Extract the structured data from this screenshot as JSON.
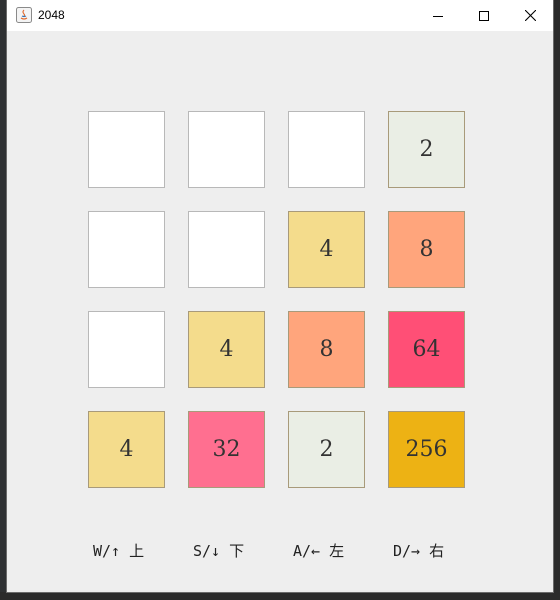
{
  "window": {
    "title": "2048"
  },
  "board": {
    "rows": [
      [
        {
          "value": ""
        },
        {
          "value": ""
        },
        {
          "value": ""
        },
        {
          "value": "2"
        }
      ],
      [
        {
          "value": ""
        },
        {
          "value": ""
        },
        {
          "value": "4"
        },
        {
          "value": "8"
        }
      ],
      [
        {
          "value": ""
        },
        {
          "value": "4"
        },
        {
          "value": "8"
        },
        {
          "value": "64"
        }
      ],
      [
        {
          "value": "4"
        },
        {
          "value": "32"
        },
        {
          "value": "2"
        },
        {
          "value": "256"
        }
      ]
    ],
    "colors": {
      "empty": "#ffffff",
      "2": "#eaeee5",
      "4": "#f4dc8c",
      "8": "#ffa57c",
      "32": "#ff6f90",
      "64": "#ff4f76",
      "256": "#edb214"
    }
  },
  "controls": [
    {
      "label": "W/↑ 上",
      "icon": "arrow-up-icon"
    },
    {
      "label": "S/↓ 下",
      "icon": "arrow-down-icon"
    },
    {
      "label": "A/← 左",
      "icon": "arrow-left-icon"
    },
    {
      "label": "D/→ 右",
      "icon": "arrow-right-icon"
    }
  ]
}
